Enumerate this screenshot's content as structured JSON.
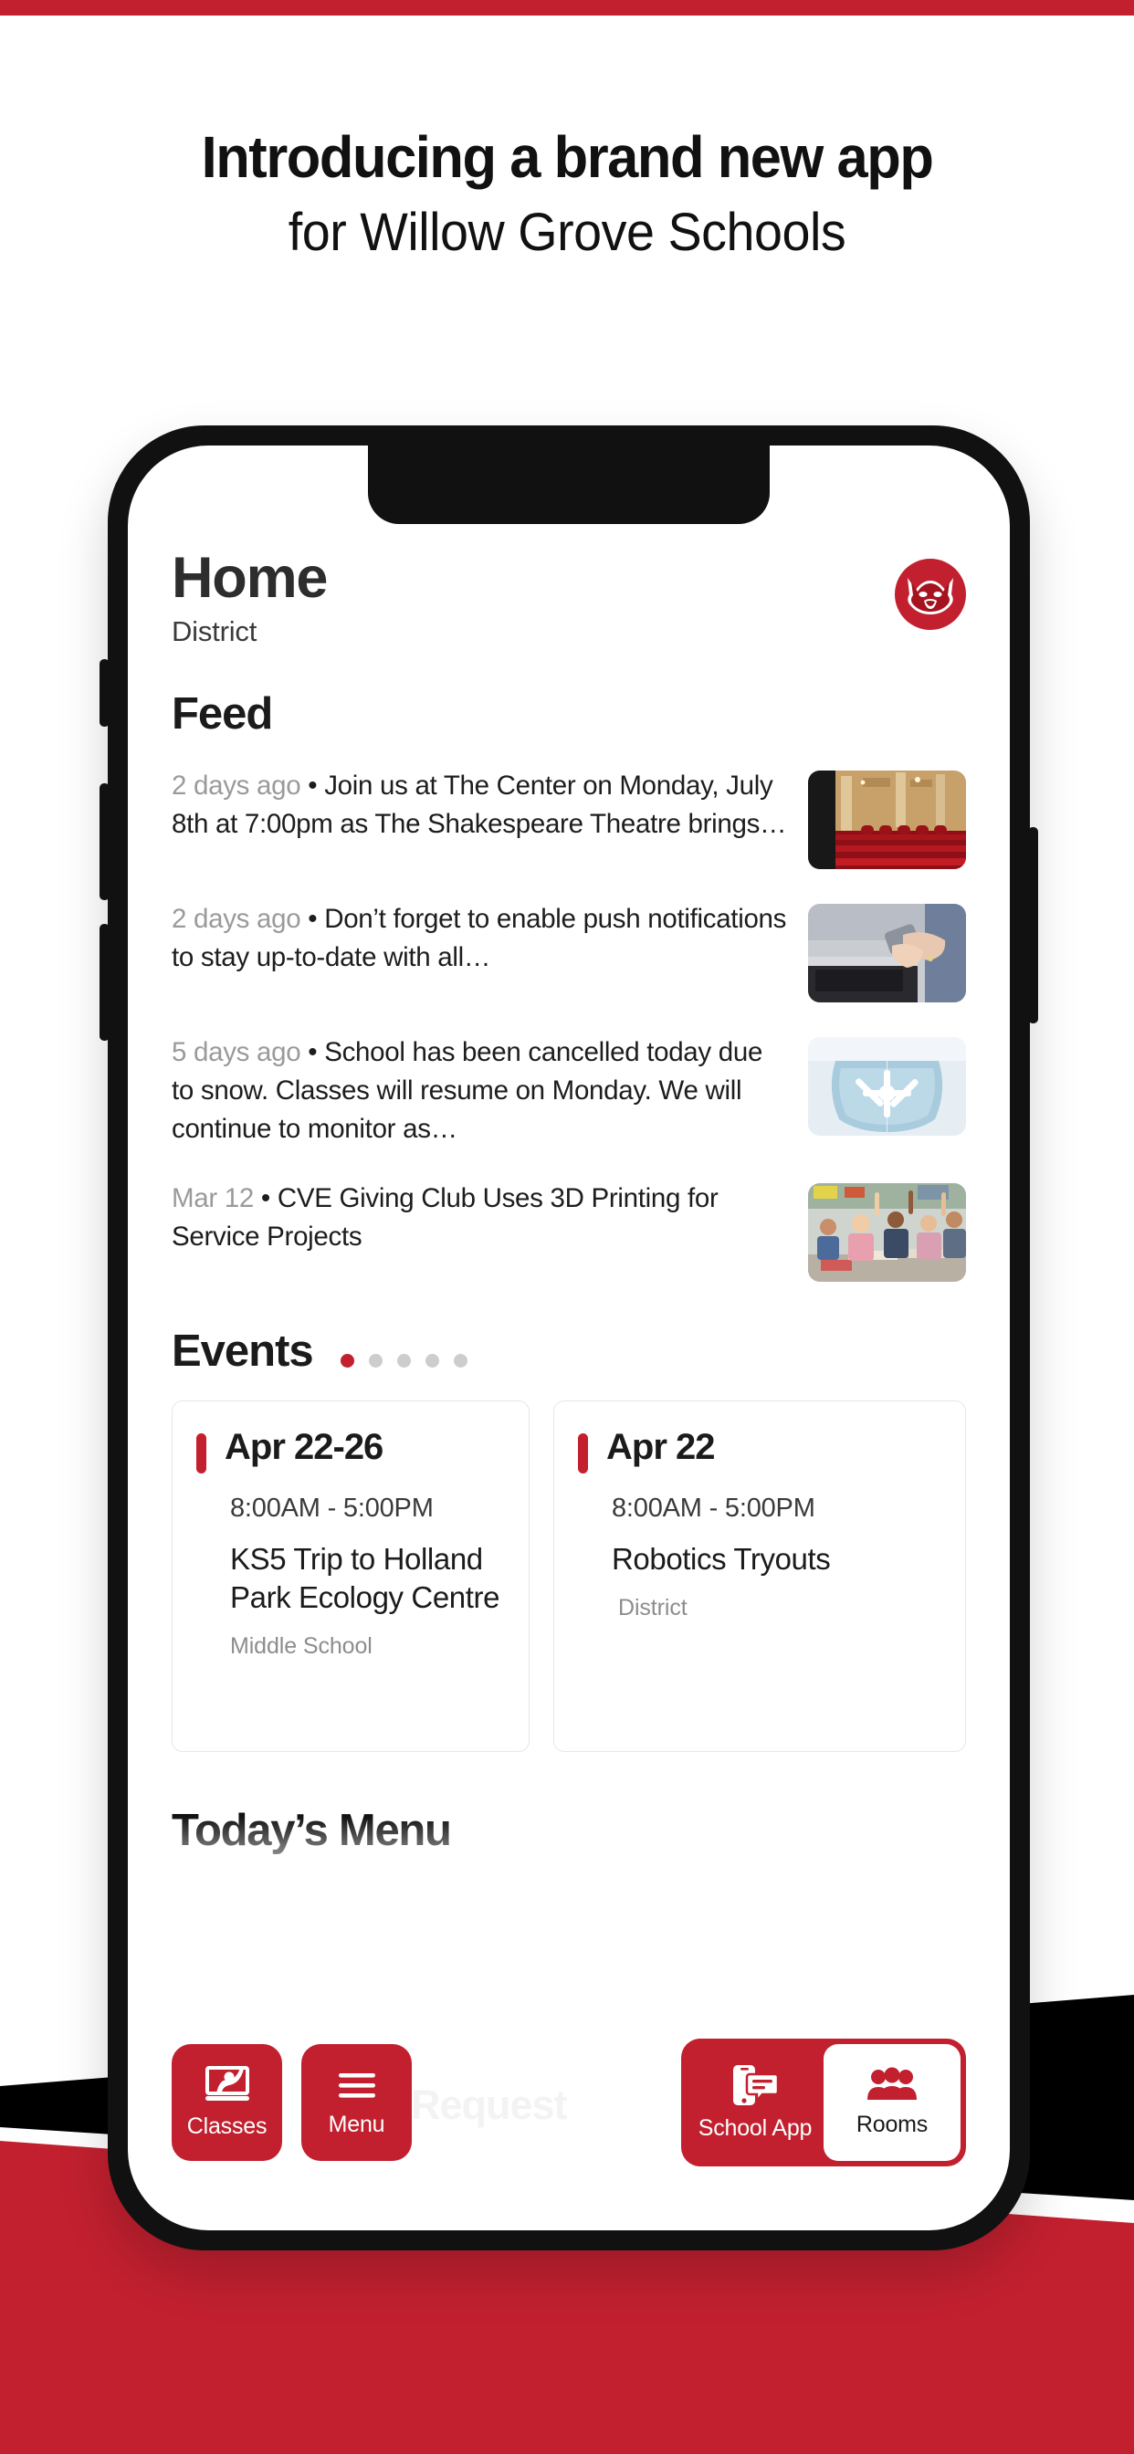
{
  "promo": {
    "headline_line1": "Introducing a brand new app",
    "headline_line2": "for Willow Grove Schools"
  },
  "colors": {
    "brand_red": "#c2202f",
    "frame_black": "#111111",
    "muted_gray": "#9a9a9a",
    "card_border": "#e6e6ee"
  },
  "app": {
    "header": {
      "title": "Home",
      "subtitle": "District",
      "logo_name": "wildcat-mascot-logo"
    },
    "feed": {
      "title": "Feed",
      "items": [
        {
          "time": "2 days ago",
          "separator": "•",
          "text": "Join us at The Center on Monday, July 8th at 7:00pm as The Shakespeare Theatre brings…",
          "thumb_name": "theatre-seats-thumbnail"
        },
        {
          "time": "2 days ago",
          "separator": "•",
          "text": "Don’t forget to enable push notifications to stay up-to-date with all…",
          "thumb_name": "hands-phone-laptop-thumbnail"
        },
        {
          "time": "5 days ago",
          "separator": "•",
          "text": "School has been cancelled today due to snow. Classes will resume on Monday. We will continue to monitor as…",
          "thumb_name": "snowflake-mittens-thumbnail"
        },
        {
          "time": "Mar 12",
          "separator": "•",
          "text": "CVE Giving Club Uses 3D Printing for Service Projects",
          "thumb_name": "classroom-students-thumbnail"
        }
      ]
    },
    "events": {
      "title": "Events",
      "pagination": {
        "total": 5,
        "active_index": 0
      },
      "cards": [
        {
          "date": "Apr 22-26",
          "time": "8:00AM  -  5:00PM",
          "name": "KS5 Trip to Holland Park Ecology Centre",
          "scope": "Middle School"
        },
        {
          "date": "Apr 22",
          "time": "8:00AM  -  5:00PM",
          "name": "Robotics Tryouts",
          "scope": "District"
        }
      ]
    },
    "menu_section": {
      "title": "Today’s Menu",
      "ghost_label": "Request"
    },
    "nav": {
      "tiles": [
        {
          "label": "Classes",
          "icon": "presentation-person-icon",
          "active": false
        },
        {
          "label": "Menu",
          "icon": "hamburger-lines-icon",
          "active": false
        }
      ],
      "group": [
        {
          "label": "School App",
          "icon": "phone-message-icon",
          "active": false
        },
        {
          "label": "Rooms",
          "icon": "people-group-icon",
          "active": true
        }
      ]
    }
  }
}
